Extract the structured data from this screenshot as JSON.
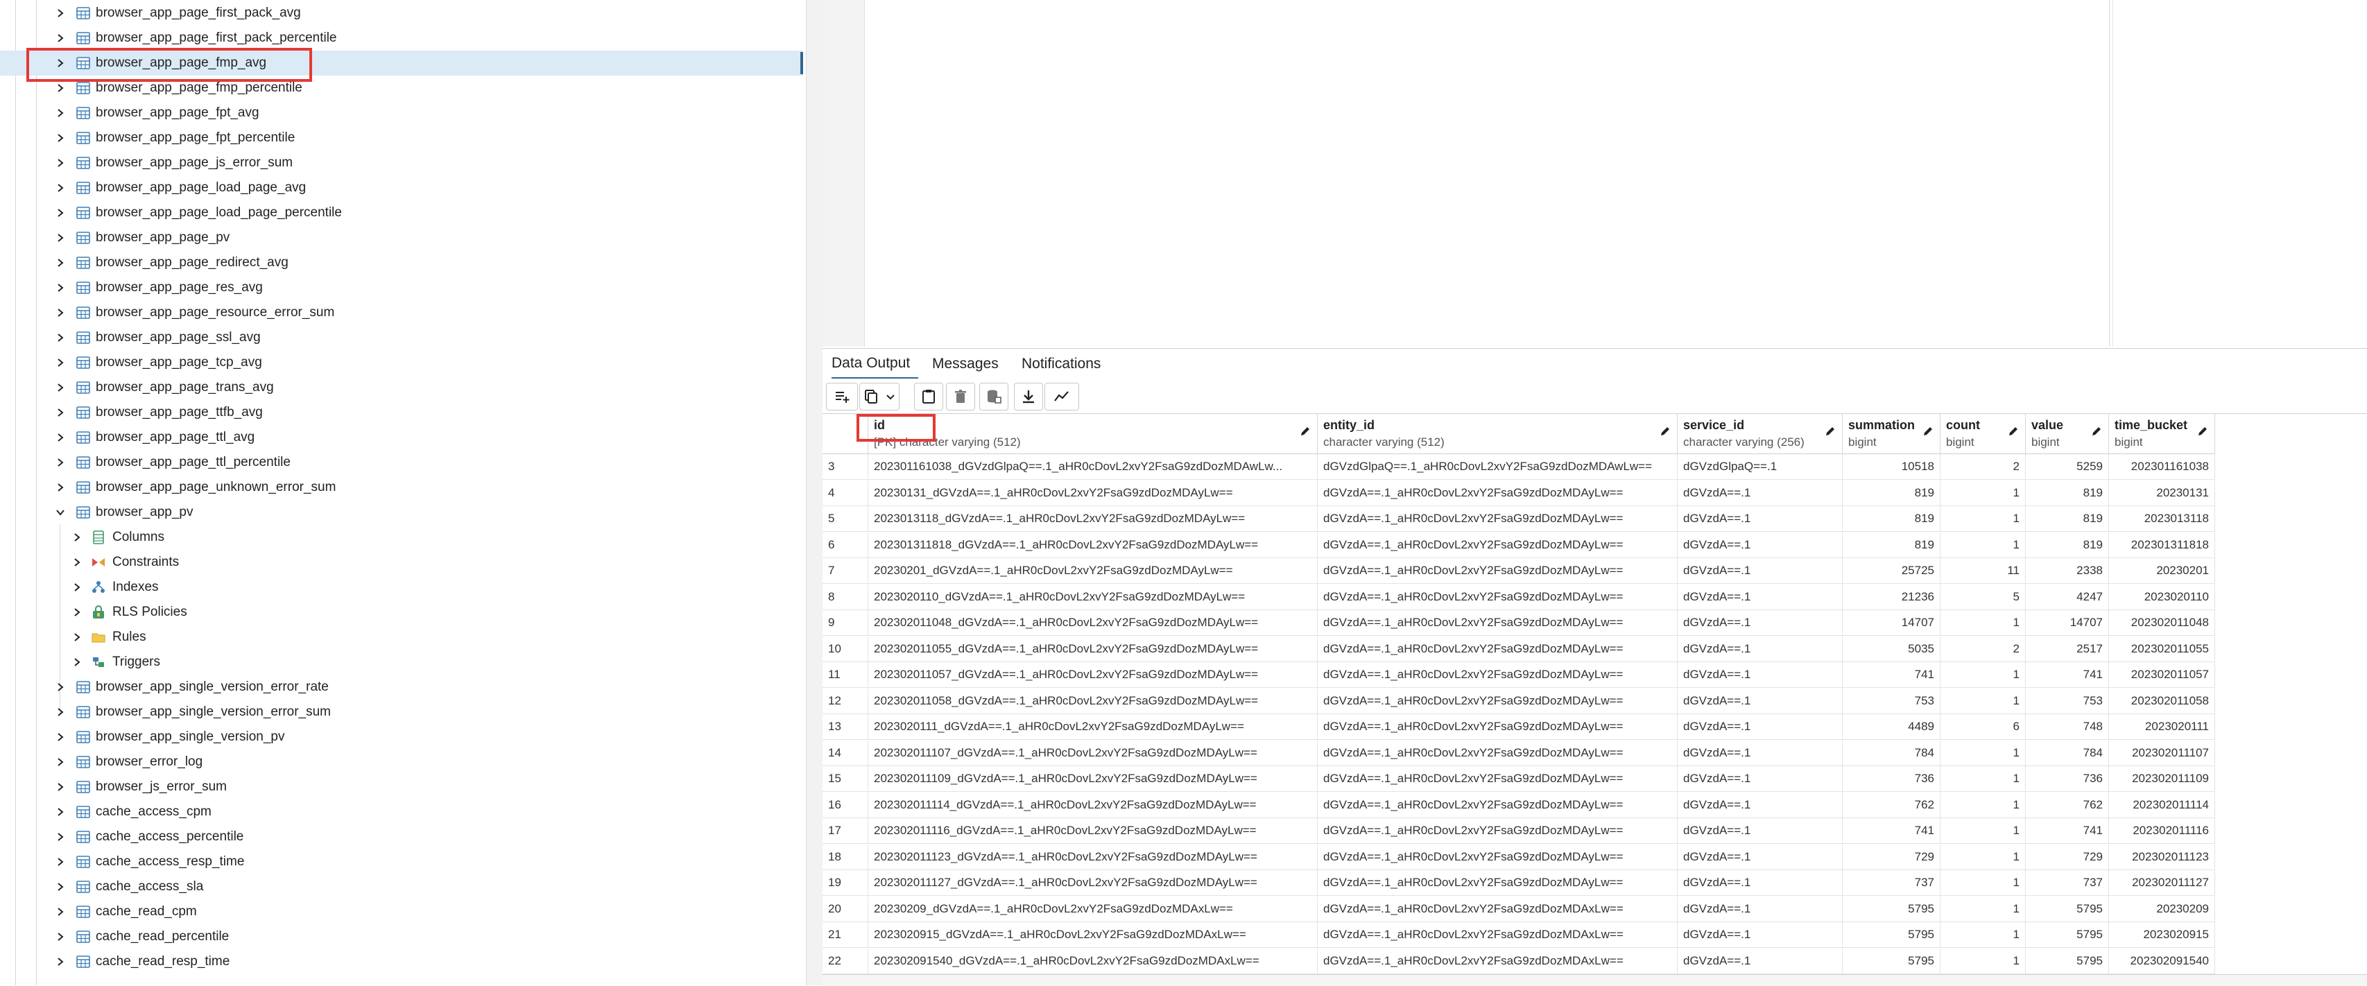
{
  "tree": {
    "items": [
      {
        "label": "browser_app_page_first_pack_avg",
        "level": 1,
        "icon": "table-icon",
        "expanded": false,
        "selected": false
      },
      {
        "label": "browser_app_page_first_pack_percentile",
        "level": 1,
        "icon": "table-icon",
        "expanded": false,
        "selected": false
      },
      {
        "label": "browser_app_page_fmp_avg",
        "level": 1,
        "icon": "table-icon",
        "expanded": false,
        "selected": true
      },
      {
        "label": "browser_app_page_fmp_percentile",
        "level": 1,
        "icon": "table-icon",
        "expanded": false,
        "selected": false
      },
      {
        "label": "browser_app_page_fpt_avg",
        "level": 1,
        "icon": "table-icon",
        "expanded": false,
        "selected": false
      },
      {
        "label": "browser_app_page_fpt_percentile",
        "level": 1,
        "icon": "table-icon",
        "expanded": false,
        "selected": false
      },
      {
        "label": "browser_app_page_js_error_sum",
        "level": 1,
        "icon": "table-icon",
        "expanded": false,
        "selected": false
      },
      {
        "label": "browser_app_page_load_page_avg",
        "level": 1,
        "icon": "table-icon",
        "expanded": false,
        "selected": false
      },
      {
        "label": "browser_app_page_load_page_percentile",
        "level": 1,
        "icon": "table-icon",
        "expanded": false,
        "selected": false
      },
      {
        "label": "browser_app_page_pv",
        "level": 1,
        "icon": "table-icon",
        "expanded": false,
        "selected": false
      },
      {
        "label": "browser_app_page_redirect_avg",
        "level": 1,
        "icon": "table-icon",
        "expanded": false,
        "selected": false
      },
      {
        "label": "browser_app_page_res_avg",
        "level": 1,
        "icon": "table-icon",
        "expanded": false,
        "selected": false
      },
      {
        "label": "browser_app_page_resource_error_sum",
        "level": 1,
        "icon": "table-icon",
        "expanded": false,
        "selected": false
      },
      {
        "label": "browser_app_page_ssl_avg",
        "level": 1,
        "icon": "table-icon",
        "expanded": false,
        "selected": false
      },
      {
        "label": "browser_app_page_tcp_avg",
        "level": 1,
        "icon": "table-icon",
        "expanded": false,
        "selected": false
      },
      {
        "label": "browser_app_page_trans_avg",
        "level": 1,
        "icon": "table-icon",
        "expanded": false,
        "selected": false
      },
      {
        "label": "browser_app_page_ttfb_avg",
        "level": 1,
        "icon": "table-icon",
        "expanded": false,
        "selected": false
      },
      {
        "label": "browser_app_page_ttl_avg",
        "level": 1,
        "icon": "table-icon",
        "expanded": false,
        "selected": false
      },
      {
        "label": "browser_app_page_ttl_percentile",
        "level": 1,
        "icon": "table-icon",
        "expanded": false,
        "selected": false
      },
      {
        "label": "browser_app_page_unknown_error_sum",
        "level": 1,
        "icon": "table-icon",
        "expanded": false,
        "selected": false
      },
      {
        "label": "browser_app_pv",
        "level": 1,
        "icon": "table-icon",
        "expanded": true,
        "selected": false
      },
      {
        "label": "Columns",
        "level": 2,
        "icon": "columns-icon",
        "expanded": false,
        "selected": false
      },
      {
        "label": "Constraints",
        "level": 2,
        "icon": "constraints-icon",
        "expanded": false,
        "selected": false
      },
      {
        "label": "Indexes",
        "level": 2,
        "icon": "indexes-icon",
        "expanded": false,
        "selected": false
      },
      {
        "label": "RLS Policies",
        "level": 2,
        "icon": "lock-icon",
        "expanded": false,
        "selected": false
      },
      {
        "label": "Rules",
        "level": 2,
        "icon": "rules-icon",
        "expanded": false,
        "selected": false
      },
      {
        "label": "Triggers",
        "level": 2,
        "icon": "triggers-icon",
        "expanded": false,
        "selected": false
      },
      {
        "label": "browser_app_single_version_error_rate",
        "level": 1,
        "icon": "table-icon",
        "expanded": false,
        "selected": false
      },
      {
        "label": "browser_app_single_version_error_sum",
        "level": 1,
        "icon": "table-icon",
        "expanded": false,
        "selected": false
      },
      {
        "label": "browser_app_single_version_pv",
        "level": 1,
        "icon": "table-icon",
        "expanded": false,
        "selected": false
      },
      {
        "label": "browser_error_log",
        "level": 1,
        "icon": "table-icon",
        "expanded": false,
        "selected": false
      },
      {
        "label": "browser_js_error_sum",
        "level": 1,
        "icon": "table-icon",
        "expanded": false,
        "selected": false
      },
      {
        "label": "cache_access_cpm",
        "level": 1,
        "icon": "table-icon",
        "expanded": false,
        "selected": false
      },
      {
        "label": "cache_access_percentile",
        "level": 1,
        "icon": "table-icon",
        "expanded": false,
        "selected": false
      },
      {
        "label": "cache_access_resp_time",
        "level": 1,
        "icon": "table-icon",
        "expanded": false,
        "selected": false
      },
      {
        "label": "cache_access_sla",
        "level": 1,
        "icon": "table-icon",
        "expanded": false,
        "selected": false
      },
      {
        "label": "cache_read_cpm",
        "level": 1,
        "icon": "table-icon",
        "expanded": false,
        "selected": false
      },
      {
        "label": "cache_read_percentile",
        "level": 1,
        "icon": "table-icon",
        "expanded": false,
        "selected": false
      },
      {
        "label": "cache_read_resp_time",
        "level": 1,
        "icon": "table-icon",
        "expanded": false,
        "selected": false
      }
    ]
  },
  "results": {
    "tabs": [
      {
        "label": "Data Output",
        "active": true
      },
      {
        "label": "Messages",
        "active": false
      },
      {
        "label": "Notifications",
        "active": false
      }
    ],
    "toolbar": [
      {
        "name": "add-row-icon"
      },
      {
        "name": "copy-icon"
      },
      {
        "name": "copy-dropdown-chevron-icon"
      },
      {
        "name": "paste-icon"
      },
      {
        "name": "delete-icon"
      },
      {
        "name": "save-data-icon"
      },
      {
        "name": "download-icon"
      },
      {
        "name": "graph-icon"
      }
    ],
    "columns": [
      {
        "name": "id",
        "type": "[PK] character varying (512)"
      },
      {
        "name": "entity_id",
        "type": "character varying (512)"
      },
      {
        "name": "service_id",
        "type": "character varying (256)"
      },
      {
        "name": "summation",
        "type": "bigint"
      },
      {
        "name": "count",
        "type": "bigint"
      },
      {
        "name": "value",
        "type": "bigint"
      },
      {
        "name": "time_bucket",
        "type": "bigint"
      }
    ],
    "rows": [
      [
        "3",
        "202301161038_dGVzdGlpaQ==.1_aHR0cDovL2xvY2FsaG9zdDozMDAwLw...",
        "dGVzdGlpaQ==.1_aHR0cDovL2xvY2FsaG9zdDozMDAwLw==",
        "dGVzdGlpaQ==.1",
        "10518",
        "2",
        "5259",
        "202301161038"
      ],
      [
        "4",
        "20230131_dGVzdA==.1_aHR0cDovL2xvY2FsaG9zdDozMDAyLw==",
        "dGVzdA==.1_aHR0cDovL2xvY2FsaG9zdDozMDAyLw==",
        "dGVzdA==.1",
        "819",
        "1",
        "819",
        "20230131"
      ],
      [
        "5",
        "2023013118_dGVzdA==.1_aHR0cDovL2xvY2FsaG9zdDozMDAyLw==",
        "dGVzdA==.1_aHR0cDovL2xvY2FsaG9zdDozMDAyLw==",
        "dGVzdA==.1",
        "819",
        "1",
        "819",
        "2023013118"
      ],
      [
        "6",
        "202301311818_dGVzdA==.1_aHR0cDovL2xvY2FsaG9zdDozMDAyLw==",
        "dGVzdA==.1_aHR0cDovL2xvY2FsaG9zdDozMDAyLw==",
        "dGVzdA==.1",
        "819",
        "1",
        "819",
        "202301311818"
      ],
      [
        "7",
        "20230201_dGVzdA==.1_aHR0cDovL2xvY2FsaG9zdDozMDAyLw==",
        "dGVzdA==.1_aHR0cDovL2xvY2FsaG9zdDozMDAyLw==",
        "dGVzdA==.1",
        "25725",
        "11",
        "2338",
        "20230201"
      ],
      [
        "8",
        "2023020110_dGVzdA==.1_aHR0cDovL2xvY2FsaG9zdDozMDAyLw==",
        "dGVzdA==.1_aHR0cDovL2xvY2FsaG9zdDozMDAyLw==",
        "dGVzdA==.1",
        "21236",
        "5",
        "4247",
        "2023020110"
      ],
      [
        "9",
        "202302011048_dGVzdA==.1_aHR0cDovL2xvY2FsaG9zdDozMDAyLw==",
        "dGVzdA==.1_aHR0cDovL2xvY2FsaG9zdDozMDAyLw==",
        "dGVzdA==.1",
        "14707",
        "1",
        "14707",
        "202302011048"
      ],
      [
        "10",
        "202302011055_dGVzdA==.1_aHR0cDovL2xvY2FsaG9zdDozMDAyLw==",
        "dGVzdA==.1_aHR0cDovL2xvY2FsaG9zdDozMDAyLw==",
        "dGVzdA==.1",
        "5035",
        "2",
        "2517",
        "202302011055"
      ],
      [
        "11",
        "202302011057_dGVzdA==.1_aHR0cDovL2xvY2FsaG9zdDozMDAyLw==",
        "dGVzdA==.1_aHR0cDovL2xvY2FsaG9zdDozMDAyLw==",
        "dGVzdA==.1",
        "741",
        "1",
        "741",
        "202302011057"
      ],
      [
        "12",
        "202302011058_dGVzdA==.1_aHR0cDovL2xvY2FsaG9zdDozMDAyLw==",
        "dGVzdA==.1_aHR0cDovL2xvY2FsaG9zdDozMDAyLw==",
        "dGVzdA==.1",
        "753",
        "1",
        "753",
        "202302011058"
      ],
      [
        "13",
        "2023020111_dGVzdA==.1_aHR0cDovL2xvY2FsaG9zdDozMDAyLw==",
        "dGVzdA==.1_aHR0cDovL2xvY2FsaG9zdDozMDAyLw==",
        "dGVzdA==.1",
        "4489",
        "6",
        "748",
        "2023020111"
      ],
      [
        "14",
        "202302011107_dGVzdA==.1_aHR0cDovL2xvY2FsaG9zdDozMDAyLw==",
        "dGVzdA==.1_aHR0cDovL2xvY2FsaG9zdDozMDAyLw==",
        "dGVzdA==.1",
        "784",
        "1",
        "784",
        "202302011107"
      ],
      [
        "15",
        "202302011109_dGVzdA==.1_aHR0cDovL2xvY2FsaG9zdDozMDAyLw==",
        "dGVzdA==.1_aHR0cDovL2xvY2FsaG9zdDozMDAyLw==",
        "dGVzdA==.1",
        "736",
        "1",
        "736",
        "202302011109"
      ],
      [
        "16",
        "202302011114_dGVzdA==.1_aHR0cDovL2xvY2FsaG9zdDozMDAyLw==",
        "dGVzdA==.1_aHR0cDovL2xvY2FsaG9zdDozMDAyLw==",
        "dGVzdA==.1",
        "762",
        "1",
        "762",
        "202302011114"
      ],
      [
        "17",
        "202302011116_dGVzdA==.1_aHR0cDovL2xvY2FsaG9zdDozMDAyLw==",
        "dGVzdA==.1_aHR0cDovL2xvY2FsaG9zdDozMDAyLw==",
        "dGVzdA==.1",
        "741",
        "1",
        "741",
        "202302011116"
      ],
      [
        "18",
        "202302011123_dGVzdA==.1_aHR0cDovL2xvY2FsaG9zdDozMDAyLw==",
        "dGVzdA==.1_aHR0cDovL2xvY2FsaG9zdDozMDAyLw==",
        "dGVzdA==.1",
        "729",
        "1",
        "729",
        "202302011123"
      ],
      [
        "19",
        "202302011127_dGVzdA==.1_aHR0cDovL2xvY2FsaG9zdDozMDAyLw==",
        "dGVzdA==.1_aHR0cDovL2xvY2FsaG9zdDozMDAyLw==",
        "dGVzdA==.1",
        "737",
        "1",
        "737",
        "202302011127"
      ],
      [
        "20",
        "20230209_dGVzdA==.1_aHR0cDovL2xvY2FsaG9zdDozMDAxLw==",
        "dGVzdA==.1_aHR0cDovL2xvY2FsaG9zdDozMDAxLw==",
        "dGVzdA==.1",
        "5795",
        "1",
        "5795",
        "20230209"
      ],
      [
        "21",
        "2023020915_dGVzdA==.1_aHR0cDovL2xvY2FsaG9zdDozMDAxLw==",
        "dGVzdA==.1_aHR0cDovL2xvY2FsaG9zdDozMDAxLw==",
        "dGVzdA==.1",
        "5795",
        "1",
        "5795",
        "2023020915"
      ],
      [
        "22",
        "202302091540_dGVzdA==.1_aHR0cDovL2xvY2FsaG9zdDozMDAxLw==",
        "dGVzdA==.1_aHR0cDovL2xvY2FsaG9zdDozMDAxLw==",
        "dGVzdA==.1",
        "5795",
        "1",
        "5795",
        "202302091540"
      ]
    ]
  },
  "colors": {
    "accent": "#326690",
    "selection": "#dbeaf7",
    "highlight_box": "#e53935"
  }
}
